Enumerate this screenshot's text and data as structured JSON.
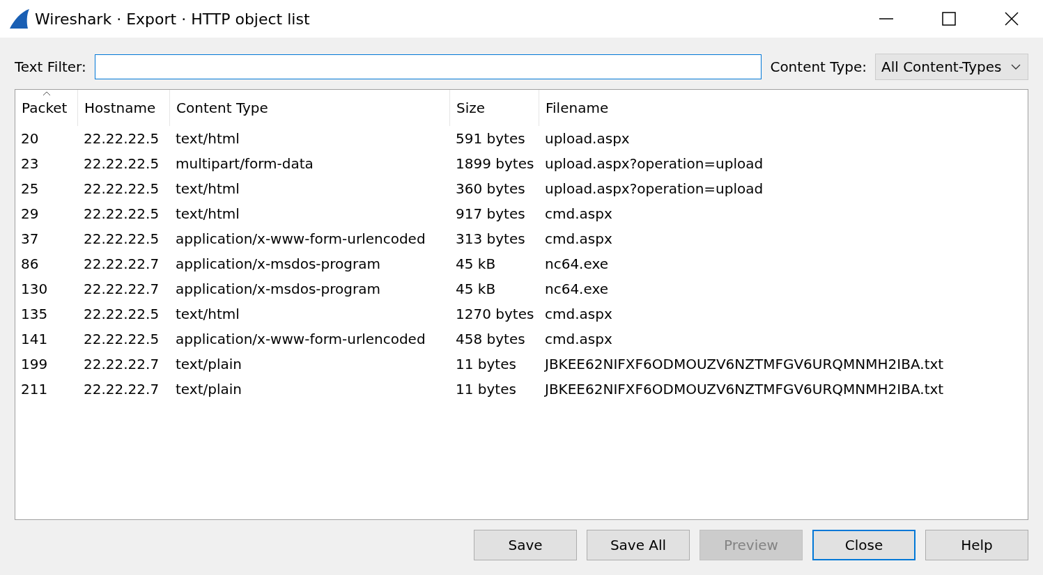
{
  "window": {
    "title": "Wireshark · Export · HTTP object list"
  },
  "filter": {
    "label": "Text Filter:"
  },
  "content_type": {
    "label": "Content Type:",
    "value": "All Content-Types"
  },
  "table": {
    "columns": [
      {
        "label": "Packet",
        "sorted": true
      },
      {
        "label": "Hostname",
        "sorted": false
      },
      {
        "label": "Content Type",
        "sorted": false
      },
      {
        "label": "Size",
        "sorted": false
      },
      {
        "label": "Filename",
        "sorted": false
      }
    ],
    "rows": [
      [
        "20",
        "22.22.22.5",
        "text/html",
        "591 bytes",
        "upload.aspx"
      ],
      [
        "23",
        "22.22.22.5",
        "multipart/form-data",
        "1899 bytes",
        "upload.aspx?operation=upload"
      ],
      [
        "25",
        "22.22.22.5",
        "text/html",
        "360 bytes",
        "upload.aspx?operation=upload"
      ],
      [
        "29",
        "22.22.22.5",
        "text/html",
        "917 bytes",
        "cmd.aspx"
      ],
      [
        "37",
        "22.22.22.5",
        "application/x-www-form-urlencoded",
        "313 bytes",
        "cmd.aspx"
      ],
      [
        "86",
        "22.22.22.7",
        "application/x-msdos-program",
        "45 kB",
        "nc64.exe"
      ],
      [
        "130",
        "22.22.22.7",
        "application/x-msdos-program",
        "45 kB",
        "nc64.exe"
      ],
      [
        "135",
        "22.22.22.5",
        "text/html",
        "1270 bytes",
        "cmd.aspx"
      ],
      [
        "141",
        "22.22.22.5",
        "application/x-www-form-urlencoded",
        "458 bytes",
        "cmd.aspx"
      ],
      [
        "199",
        "22.22.22.7",
        "text/plain",
        "11 bytes",
        "JBKEE62NIFXF6ODMOUZV6NZTMFGV6URQMNMH2IBA.txt"
      ],
      [
        "211",
        "22.22.22.7",
        "text/plain",
        "11 bytes",
        "JBKEE62NIFXF6ODMOUZV6NZTMFGV6URQMNMH2IBA.txt"
      ]
    ]
  },
  "buttons": [
    {
      "label": "Save",
      "disabled": false,
      "default": false
    },
    {
      "label": "Save All",
      "disabled": false,
      "default": false
    },
    {
      "label": "Preview",
      "disabled": true,
      "default": false
    },
    {
      "label": "Close",
      "disabled": false,
      "default": true
    },
    {
      "label": "Help",
      "disabled": false,
      "default": false
    }
  ]
}
